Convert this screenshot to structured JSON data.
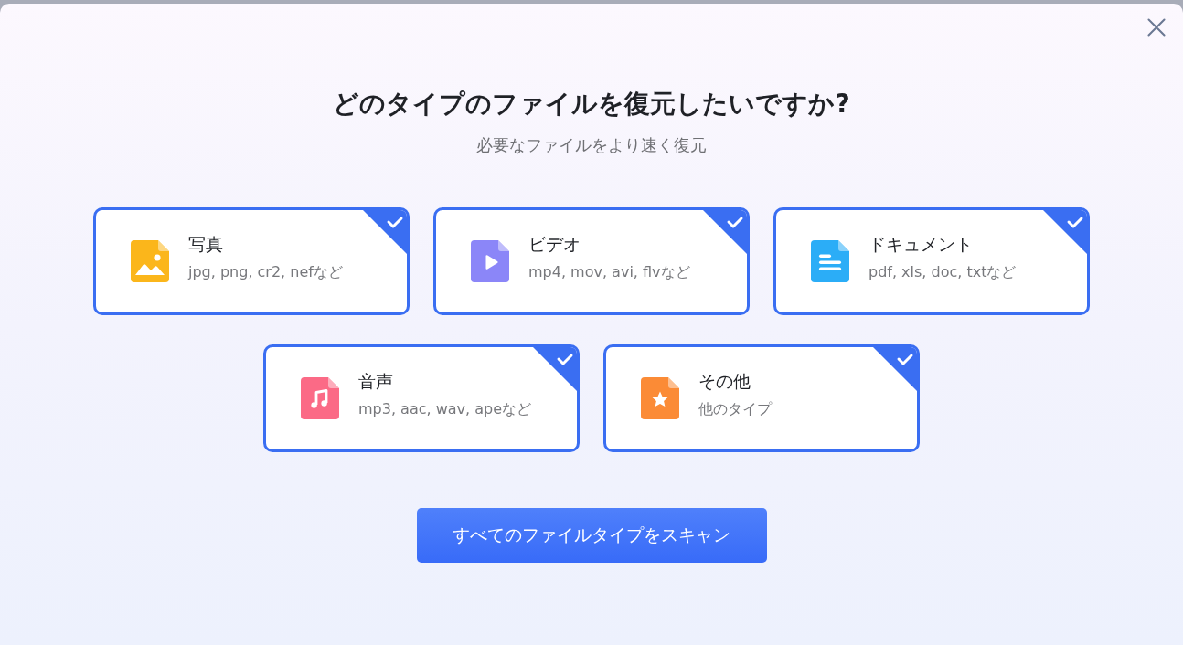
{
  "dialog": {
    "title": "どのタイプのファイルを復元したいですか?",
    "subtitle": "必要なファイルをより速く復元",
    "file_types": [
      {
        "kind": "image",
        "name": "写真",
        "formats": "jpg, png, cr2, nefなど",
        "color": "#fbb61b",
        "selected": true
      },
      {
        "kind": "video",
        "name": "ビデオ",
        "formats": "mp4, mov, avi, flvなど",
        "color": "#8b86f8",
        "selected": true
      },
      {
        "kind": "document",
        "name": "ドキュメント",
        "formats": "pdf, xls, doc, txtなど",
        "color": "#2badf7",
        "selected": true
      },
      {
        "kind": "audio",
        "name": "音声",
        "formats": "mp3, aac, wav, apeなど",
        "color": "#fb6a86",
        "selected": true
      },
      {
        "kind": "other",
        "name": "その他",
        "formats": "他のタイプ",
        "color": "#fb8b36",
        "selected": true
      }
    ],
    "scan_button": "すべてのファイルタイプをスキャン"
  }
}
